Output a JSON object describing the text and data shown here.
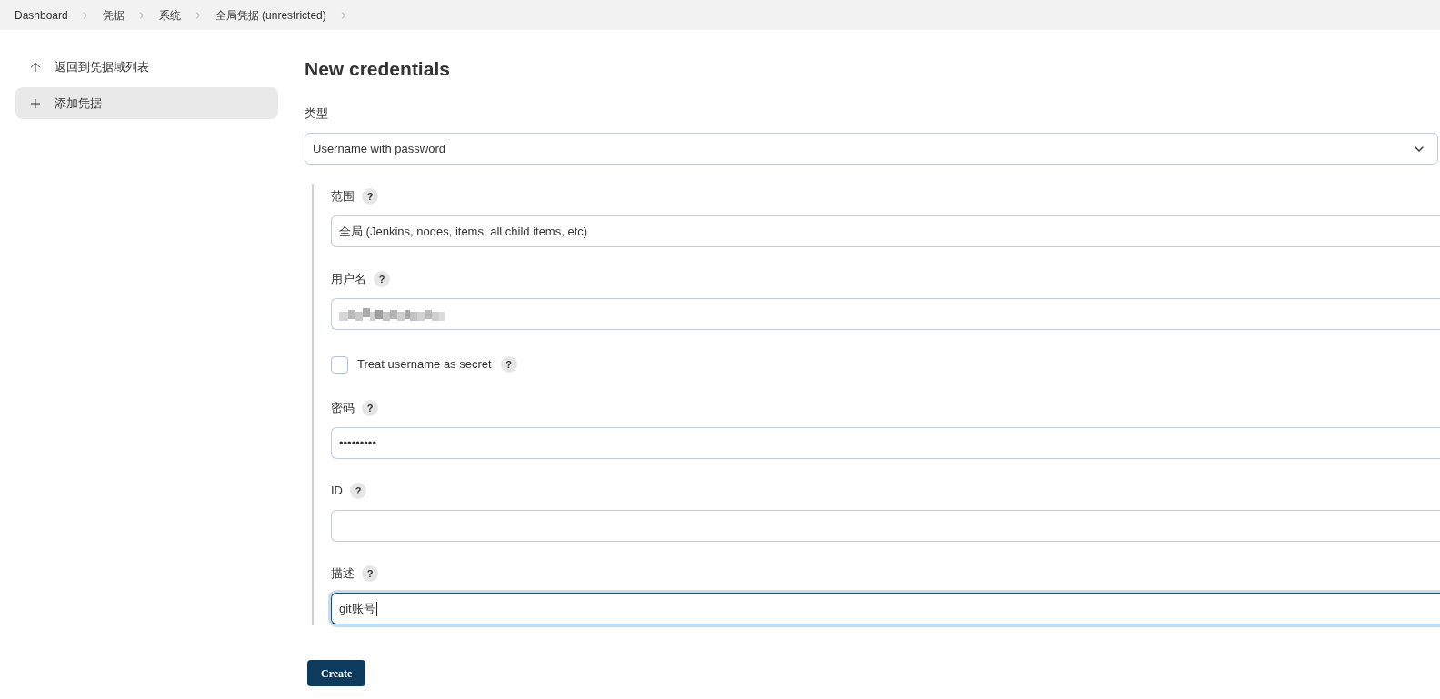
{
  "breadcrumbs": [
    {
      "label": "Dashboard"
    },
    {
      "label": "凭据"
    },
    {
      "label": "系统"
    },
    {
      "label": "全局凭据 (unrestricted)"
    }
  ],
  "sidebar": {
    "items": [
      {
        "kind": "back",
        "label": "返回到凭据域列表",
        "selected": false
      },
      {
        "kind": "add",
        "label": "添加凭据",
        "selected": true
      }
    ]
  },
  "page": {
    "title": "New credentials"
  },
  "type_field": {
    "label": "类型",
    "value": "Username with password"
  },
  "fields": [
    {
      "kind": "text",
      "label": "范围",
      "help": "?",
      "value": "全局 (Jenkins, nodes, items, all child items, etc)",
      "focused": false
    },
    {
      "kind": "redacted",
      "label": "用户名",
      "help": "?",
      "focused": false
    },
    {
      "kind": "checkbox",
      "label": "Treat username as secret",
      "help": "?",
      "checked": false
    },
    {
      "kind": "text",
      "label": "密码",
      "help": "?",
      "value": "•••••••••",
      "focused": false
    },
    {
      "kind": "text",
      "label": "ID",
      "help": "?",
      "focused": false
    },
    {
      "kind": "text",
      "label": "描述",
      "help": "?",
      "value": "git账号",
      "focused": true
    }
  ],
  "submit": {
    "label": "Create"
  }
}
